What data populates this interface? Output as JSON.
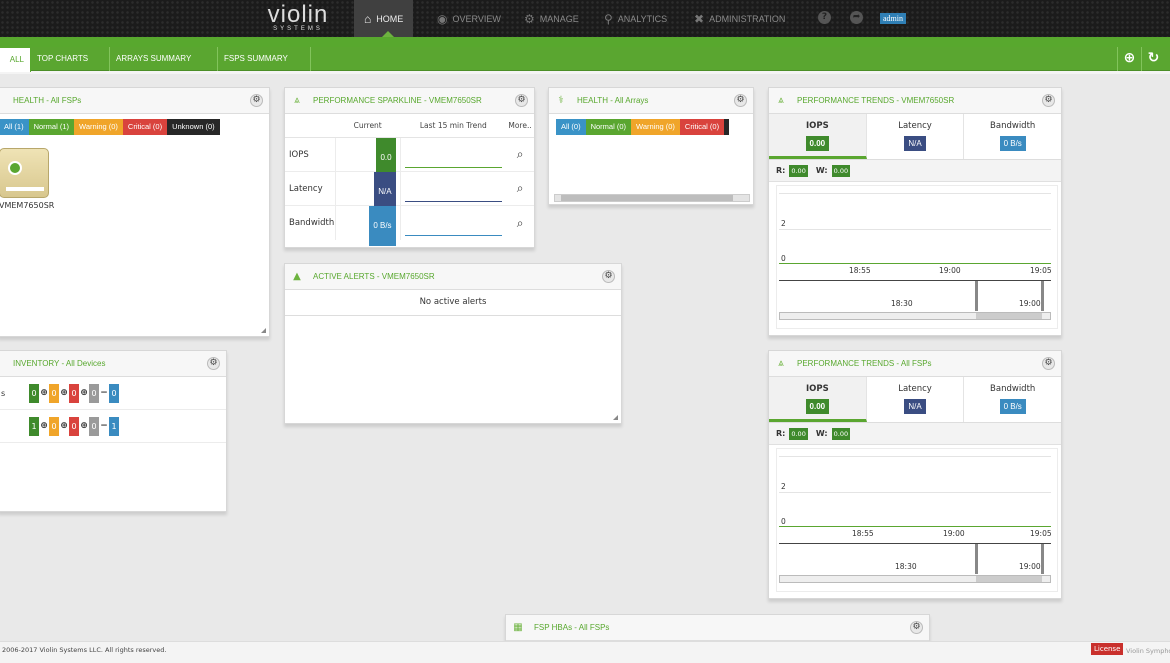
{
  "topnav": {
    "logo_main": "violin",
    "logo_sub": "SYSTEMS",
    "items": [
      {
        "label": "HOME",
        "icon": "home-icon"
      },
      {
        "label": "OVERVIEW",
        "icon": "eye-icon"
      },
      {
        "label": "MANAGE",
        "icon": "gear-icon"
      },
      {
        "label": "ANALYTICS",
        "icon": "search-icon"
      },
      {
        "label": "ADMINISTRATION",
        "icon": "wrench-icon"
      }
    ],
    "user": "admin",
    "help_icon": "help-icon",
    "share_icon": "share-icon"
  },
  "tabs": [
    {
      "label": "ALL"
    },
    {
      "label": "TOP CHARTS"
    },
    {
      "label": "ARRAYS SUMMARY"
    },
    {
      "label": "FSPS SUMMARY"
    }
  ],
  "health_fsps": {
    "title": "HEALTH - All FSPs",
    "filters": [
      {
        "label": "All (1)"
      },
      {
        "label": "Normal (1)"
      },
      {
        "label": "Warning (0)"
      },
      {
        "label": "Critical (0)"
      },
      {
        "label": "Unknown (0)"
      }
    ],
    "device_label": "VMEM7650SR"
  },
  "sparkline": {
    "title": "PERFORMANCE SPARKLINE - VMEM7650SR",
    "headers": {
      "current": "Current",
      "trend": "Last 15 min Trend",
      "more": "More.."
    },
    "rows": [
      {
        "label": "IOPS",
        "value": "0.0"
      },
      {
        "label": "Latency",
        "value": "N/A"
      },
      {
        "label": "Bandwidth",
        "value": "0 B/s"
      }
    ]
  },
  "health_arrays": {
    "title": "HEALTH - All Arrays",
    "filters": [
      {
        "label": "All (0)"
      },
      {
        "label": "Normal (0)"
      },
      {
        "label": "Warning (0)"
      },
      {
        "label": "Critical (0)"
      }
    ]
  },
  "alerts": {
    "title": "ACTIVE ALERTS - VMEM7650SR",
    "message": "No active alerts"
  },
  "inventory": {
    "title": "INVENTORY - All Devices",
    "rows": [
      {
        "label": "s",
        "values": [
          "0",
          "0",
          "0",
          "0"
        ],
        "total": "0"
      },
      {
        "label": "",
        "values": [
          "1",
          "0",
          "0",
          "0"
        ],
        "total": "1"
      }
    ]
  },
  "trend1": {
    "title": "PERFORMANCE TRENDS - VMEM7650SR",
    "tabs": [
      {
        "label": "IOPS",
        "value": "0.00"
      },
      {
        "label": "Latency",
        "value": "N/A"
      },
      {
        "label": "Bandwidth",
        "value": "0 B/s"
      }
    ],
    "r_label": "R:",
    "r_value": "0.00",
    "w_label": "W:",
    "w_value": "0.00",
    "y_ticks": [
      "2",
      "0"
    ],
    "x_ticks": [
      "18:55",
      "19:00",
      "19:05"
    ],
    "nav_ticks": [
      "18:30",
      "19:00"
    ]
  },
  "trend2": {
    "title": "PERFORMANCE TRENDS - All FSPs",
    "tabs": [
      {
        "label": "IOPS",
        "value": "0.00"
      },
      {
        "label": "Latency",
        "value": "N/A"
      },
      {
        "label": "Bandwidth",
        "value": "0 B/s"
      }
    ],
    "r_label": "R:",
    "r_value": "0.00",
    "w_label": "W:",
    "w_value": "0.00",
    "y_ticks": [
      "2",
      "0"
    ],
    "x_ticks": [
      "18:55",
      "19:00",
      "19:05"
    ],
    "nav_ticks": [
      "18:30",
      "19:00"
    ]
  },
  "hbas": {
    "title": "FSP HBAs - All FSPs"
  },
  "footer": {
    "copyright": "2006-2017 Violin Systems LLC. All rights reserved.",
    "license": "License",
    "product": "Violin Symphony"
  },
  "colors": {
    "accent_green": "#5aa630",
    "warning": "#f0a52a",
    "critical": "#d9433d",
    "info_blue": "#3a93c7"
  }
}
